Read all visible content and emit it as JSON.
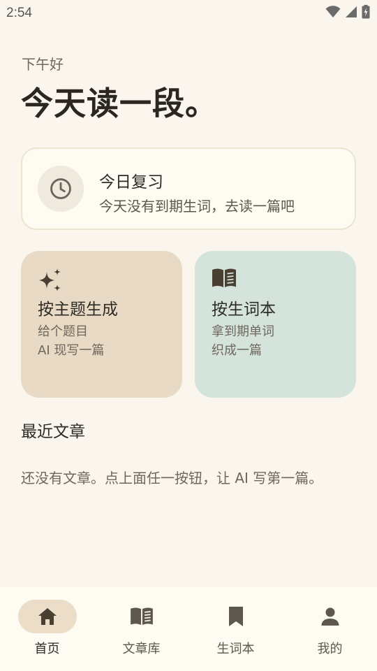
{
  "status_bar": {
    "time": "2:54"
  },
  "greeting": "下午好",
  "headline": "今天读一段。",
  "review_card": {
    "title": "今日复习",
    "subtitle": "今天没有到期生词，去读一篇吧",
    "icon": "clock-icon"
  },
  "actions": [
    {
      "title": "按主题生成",
      "line1": "给个题目",
      "line2": "AI 现写一篇",
      "icon": "sparkles-icon",
      "color": "#E8DAC5"
    },
    {
      "title": "按生词本",
      "line1": "拿到期单词",
      "line2": "织成一篇",
      "icon": "book-icon",
      "color": "#D5E3DD"
    }
  ],
  "recent": {
    "title": "最近文章",
    "empty_text": "还没有文章。点上面任一按钮，让 AI 写第一篇。"
  },
  "nav": [
    {
      "label": "首页",
      "icon": "home-icon",
      "active": true
    },
    {
      "label": "文章库",
      "icon": "library-icon",
      "active": false
    },
    {
      "label": "生词本",
      "icon": "bookmark-icon",
      "active": false
    },
    {
      "label": "我的",
      "icon": "person-icon",
      "active": false
    }
  ],
  "colors": {
    "background": "#FAF6EE",
    "accent_dark": "#4A3F33",
    "nav_active": "#EBDDC8"
  }
}
